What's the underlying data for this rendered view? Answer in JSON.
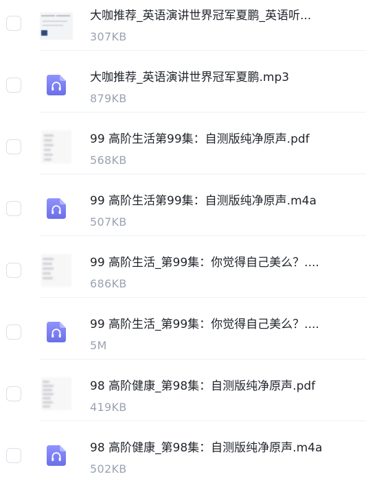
{
  "files": [
    {
      "name": "大咖推荐_英语演讲世界冠军夏鹏_英语听...",
      "size": "307KB",
      "thumb_type": "cover",
      "icon": "document-cover-thumbnail"
    },
    {
      "name": "大咖推荐_英语演讲世界冠军夏鹏.mp3",
      "size": "879KB",
      "thumb_type": "audio",
      "icon": "headphones-icon"
    },
    {
      "name": "99 高阶生活第99集：自测版纯净原声.pdf",
      "size": "568KB",
      "thumb_type": "doc",
      "icon": "pdf-thumbnail"
    },
    {
      "name": "99 高阶生活第99集：自测版纯净原声.m4a",
      "size": "507KB",
      "thumb_type": "audio",
      "icon": "headphones-icon"
    },
    {
      "name": "99 高阶生活_第99集：你觉得自己美么？....",
      "size": "686KB",
      "thumb_type": "doc",
      "icon": "pdf-thumbnail"
    },
    {
      "name": "99 高阶生活_第99集：你觉得自己美么？....",
      "size": "5M",
      "thumb_type": "audio",
      "icon": "headphones-icon"
    },
    {
      "name": "98 高阶健康_第98集：自测版纯净原声.pdf",
      "size": "419KB",
      "thumb_type": "doc",
      "icon": "pdf-thumbnail"
    },
    {
      "name": "98 高阶健康_第98集：自测版纯净原声.m4a",
      "size": "502KB",
      "thumb_type": "audio",
      "icon": "headphones-icon"
    }
  ],
  "colors": {
    "audio_icon_gradient_top": "#8f93ff",
    "audio_icon_gradient_bottom": "#6b6fe8",
    "file_name": "#1f2329",
    "file_size": "#9aa2b1",
    "checkbox_border": "#dcdfe6",
    "divider": "#eef0f4"
  }
}
